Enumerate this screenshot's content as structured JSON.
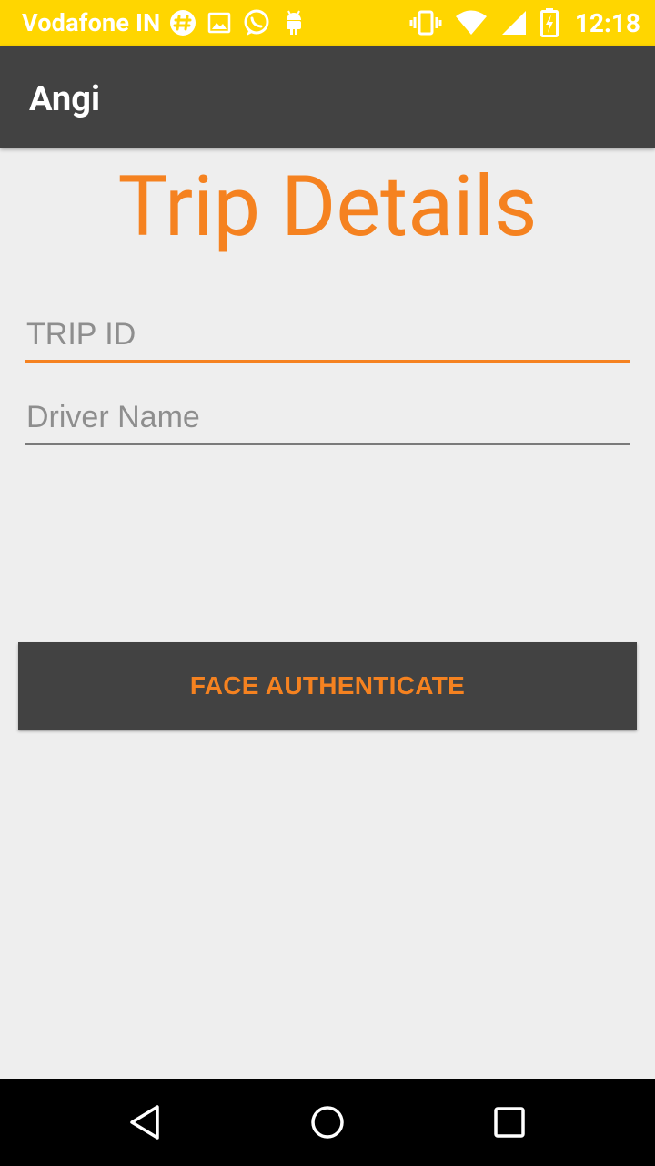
{
  "status_bar": {
    "carrier": "Vodafone IN",
    "time": "12:18",
    "left_icons": [
      "slack-icon",
      "image-icon",
      "whatsapp-icon",
      "android-icon"
    ],
    "right_icons": [
      "vibrate-icon",
      "wifi-icon",
      "signal-icon",
      "battery-charging-icon"
    ],
    "background": "#ffd600"
  },
  "app_bar": {
    "title": "Angi",
    "background": "#424242"
  },
  "main": {
    "heading": "Trip Details",
    "trip_id": {
      "value": "",
      "placeholder": "TRIP ID"
    },
    "driver_name": {
      "value": "",
      "placeholder": "Driver Name"
    },
    "face_auth_label": "FACE AUTHENTICATE",
    "accent": "#f58220"
  },
  "nav_bar": {
    "icons": [
      "back-icon",
      "home-icon",
      "recents-icon"
    ]
  }
}
